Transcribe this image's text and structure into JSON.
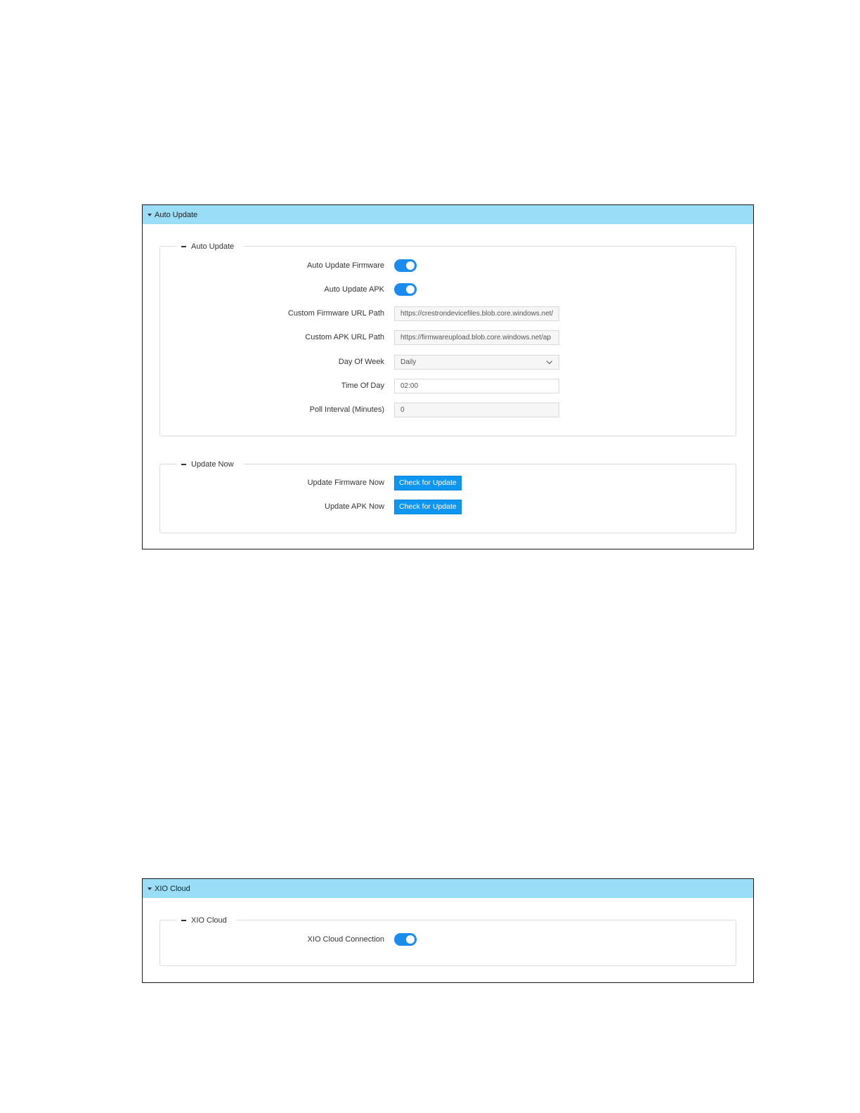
{
  "auto_update_panel": {
    "header_title": "Auto Update",
    "auto_update_section": {
      "legend": "Auto Update",
      "fields": {
        "auto_update_firmware": {
          "label": "Auto Update Firmware",
          "enabled": true
        },
        "auto_update_apk": {
          "label": "Auto Update APK",
          "enabled": true
        },
        "custom_firmware_url": {
          "label": "Custom Firmware URL Path",
          "value": "https://crestrondevicefiles.blob.core.windows.net/"
        },
        "custom_apk_url": {
          "label": "Custom APK URL Path",
          "value": "https://firmwareupload.blob.core.windows.net/ap"
        },
        "day_of_week": {
          "label": "Day Of Week",
          "value": "Daily"
        },
        "time_of_day": {
          "label": "Time Of Day",
          "value": "02:00"
        },
        "poll_interval": {
          "label": "Poll Interval (Minutes)",
          "value": "0"
        }
      }
    },
    "update_now_section": {
      "legend": "Update Now",
      "update_firmware_now": {
        "label": "Update Firmware Now",
        "button": "Check for Update"
      },
      "update_apk_now": {
        "label": "Update APK Now",
        "button": "Check for Update"
      }
    }
  },
  "xio_cloud_panel": {
    "header_title": "XIO Cloud",
    "section": {
      "legend": "XIO Cloud",
      "xio_cloud_connection": {
        "label": "XIO Cloud Connection",
        "enabled": true
      }
    }
  },
  "colors": {
    "header_bg": "#99ddf6",
    "toggle_on": "#1a8cf0",
    "button_bg": "#0d96f2"
  },
  "icons": [
    "caret-down-icon",
    "collapse-minus-icon",
    "chevron-down-icon"
  ]
}
